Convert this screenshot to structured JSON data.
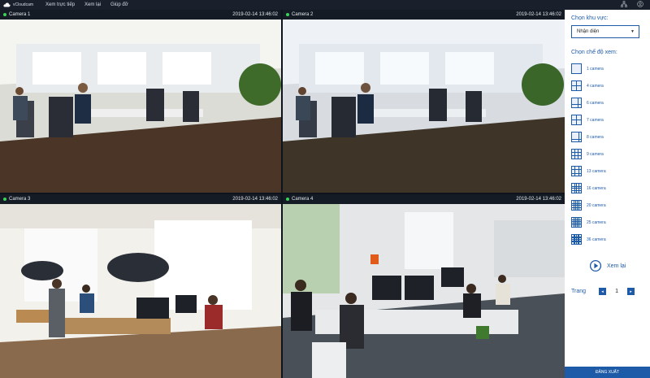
{
  "topbar": {
    "logo_text": "vCloudcam",
    "menu": [
      "Xem trực tiếp",
      "Xem lại",
      "Giúp đỡ"
    ]
  },
  "cameras": [
    {
      "name": "Camera 1",
      "timestamp": "2019-02-14  13:46:02"
    },
    {
      "name": "Camera 2",
      "timestamp": "2019-02-14  13:46:02"
    },
    {
      "name": "Camera 3",
      "timestamp": "2019-02-14  13:46:02"
    },
    {
      "name": "Camera 4",
      "timestamp": "2019-02-14  13:46:02"
    }
  ],
  "sidebar": {
    "area_label": "Chọn khu vực:",
    "area_value": "Nhận diện",
    "mode_label": "Chọn chế độ xem:",
    "modes": [
      "1 camera",
      "4 camera",
      "6 camera",
      "7 camera",
      "8 camera",
      "9 camera",
      "13 camera",
      "16 camera",
      "20 camera",
      "25 camera",
      "36 camera"
    ],
    "replay_label": "Xem lại",
    "page_label": "Trang",
    "page_prev": "◂",
    "page_number": "1",
    "page_next": "▸",
    "logout_label": "ĐĂNG XUẤT"
  },
  "colors": {
    "accent": "#1d5aa8",
    "live_dot": "#3bd15b",
    "topbar": "#1a202b"
  }
}
